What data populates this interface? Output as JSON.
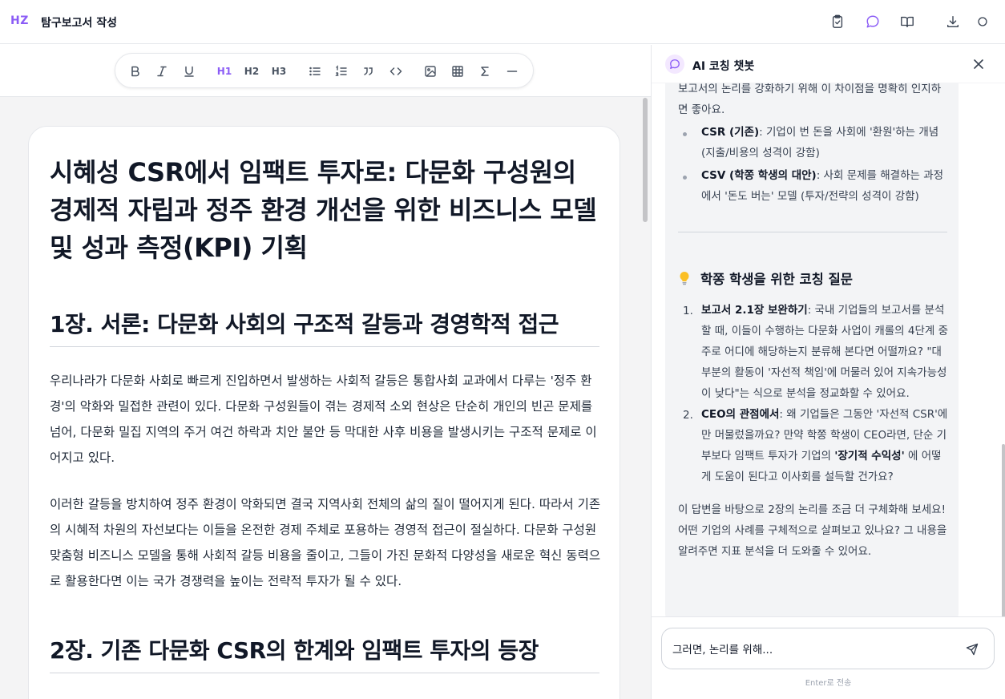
{
  "header": {
    "logo": "HZ",
    "title": "탐구보고서 작성",
    "icons": [
      "clipboard-check-icon",
      "chat-bubble-icon",
      "book-open-icon",
      "download-icon",
      "circle-icon"
    ],
    "accent_color": "#8b5cf6"
  },
  "toolbar": {
    "buttons": [
      "bold",
      "italic",
      "underline",
      "h1",
      "h2",
      "h3",
      "bullet-list",
      "ordered-list",
      "quote",
      "code",
      "image",
      "table",
      "sigma",
      "horizontal-rule"
    ],
    "h1_label": "H1",
    "h2_label": "H2",
    "h3_label": "H3",
    "active": "h1"
  },
  "document": {
    "title": "시혜성 CSR에서 임팩트 투자로: 다문화 구성원의 경제적 자립과 정주 환경 개선을 위한 비즈니스 모델 및 성과 측정(KPI) 기획",
    "section1_heading": "1장. 서론: 다문화 사회의 구조적 갈등과 경영학적 접근",
    "section1_p1": "우리나라가 다문화 사회로 빠르게 진입하면서 발생하는 사회적 갈등은 통합사회 교과에서 다루는 '정주 환경'의 악화와 밀접한 관련이 있다. 다문화 구성원들이 겪는 경제적 소외 현상은 단순히 개인의 빈곤 문제를 넘어, 다문화 밀집 지역의 주거 여건 하락과 치안 불안 등 막대한 사후 비용을 발생시키는 구조적 문제로 이어지고 있다.",
    "section1_p2": "이러한 갈등을 방치하여 정주 환경이 악화되면 결국 지역사회 전체의 삶의 질이 떨어지게 된다. 따라서 기존의 시혜적 차원의 자선보다는 이들을 온전한 경제 주체로 포용하는 경영적 접근이 절실하다. 다문화 구성원 맞춤형 비즈니스 모델을 통해 사회적 갈등 비용을 줄이고, 그들이 가진 문화적 다양성을 새로운 혁신 동력으로 활용한다면 이는 국가 경쟁력을 높이는 전략적 투자가 될 수 있다.",
    "section2_heading": "2장. 기존 다문화 CSR의 한계와 임팩트 투자의 등장"
  },
  "chat": {
    "title": "AI 코칭 챗봇",
    "intro_text": "보고서의 논리를 강화하기 위해 이 차이점을 명확히 인지하면 좋아요.",
    "bullets": [
      {
        "bold": "CSR (기존)",
        "text": ": 기업이 번 돈을 사회에 '환원'하는 개념 (지출/비용의 성격이 강함)"
      },
      {
        "bold": "CSV (학쫑 학생의 대안)",
        "text": ": 사회 문제를 해결하는 과정에서 '돈도 버는' 모델 (투자/전략의 성격이 강함)"
      }
    ],
    "coaching_heading": "학쫑 학생을 위한 코칭 질문",
    "questions": [
      {
        "num": "1.",
        "bold": "보고서 2.1장 보완하기",
        "text": ": 국내 기업들의 보고서를 분석할 때, 이들이 수행하는 다문화 사업이 캐롤의 4단계 중 주로 어디에 해당하는지 분류해 본다면 어떨까요? \"대부분의 활동이 '자선적 책임'에 머물러 있어 지속가능성이 낮다\"는 식으로 분석을 정교화할 수 있어요."
      },
      {
        "num": "2.",
        "bold": "CEO의 관점에서",
        "text_before": ": 왜 기업들은 그동안 '자선적 CSR'에만 머물렀을까요? 만약 학쫑 학생이 CEO라면, 단순 기부보다 임팩트 투자가 기업의 ",
        "bold2": "'장기적 수익성'",
        "text_after": " 에 어떻게 도움이 된다고 이사회를 설득할 건가요?"
      }
    ],
    "closing_text": "이 답변을 바탕으로 2장의 논리를 조금 더 구체화해 보세요! 어떤 기업의 사례를 구체적으로 살펴보고 있나요? 그 내용을 알려주면 지표 분석을 더 도와줄 수 있어요.",
    "input_value": "그러면, 논리를 위해...",
    "send_hint": "Enter로 전송"
  }
}
